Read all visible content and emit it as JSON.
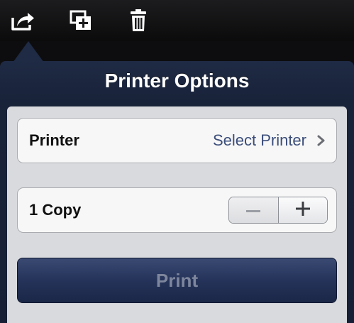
{
  "toolbar": {
    "icons": [
      "share-icon",
      "duplicate-icon",
      "trash-icon"
    ]
  },
  "popover": {
    "title": "Printer Options",
    "printer_row": {
      "label": "Printer",
      "value": "Select Printer"
    },
    "copies_row": {
      "label": "1 Copy",
      "count": 1
    },
    "print_label": "Print",
    "print_enabled": false
  },
  "colors": {
    "popover_background": "#1f2a44",
    "value_text": "#3b4d7a",
    "print_button": "#25335a",
    "print_label_disabled": "#7d869c"
  }
}
